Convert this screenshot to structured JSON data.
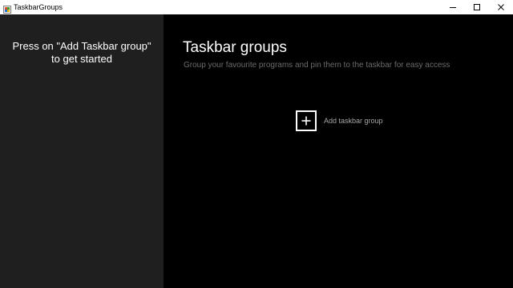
{
  "window": {
    "title": "TaskbarGroups",
    "app_icon": "taskbar-groups-app-icon",
    "controls": [
      "minimize-icon",
      "maximize-icon",
      "close-icon"
    ]
  },
  "sidebar": {
    "hint": "Press on \"Add Taskbar group\" to get started"
  },
  "main": {
    "title": "Taskbar groups",
    "subtitle": "Group your favourite programs and pin them to the taskbar for easy access",
    "add_button": {
      "icon": "plus-icon",
      "label": "Add taskbar group"
    }
  },
  "colors": {
    "titlebar_bg": "#ffffff",
    "sidebar_bg": "#1f1f1f",
    "main_bg": "#000000",
    "title_text": "#ffffff",
    "subtitle_text": "#6c6c6c",
    "add_label_text": "#a8a8a8"
  }
}
